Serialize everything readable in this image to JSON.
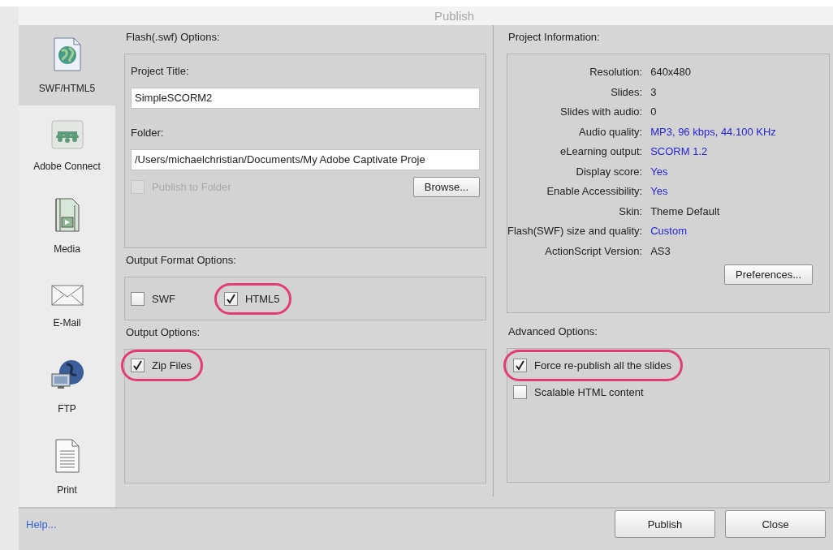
{
  "window": {
    "title": "Publish"
  },
  "sidebar": {
    "items": [
      {
        "label": "SWF/HTML5",
        "kind": "globe",
        "selected": true
      },
      {
        "label": "Adobe Connect",
        "kind": "connect",
        "selected": false
      },
      {
        "label": "Media",
        "kind": "media",
        "selected": false
      },
      {
        "label": "E-Mail",
        "kind": "mail",
        "selected": false
      },
      {
        "label": "FTP",
        "kind": "ftp",
        "selected": false
      },
      {
        "label": "Print",
        "kind": "print",
        "selected": false
      }
    ]
  },
  "flash_options": {
    "heading": "Flash(.swf) Options:",
    "project_title_label": "Project Title:",
    "project_title": "SimpleSCORM2",
    "folder_label": "Folder:",
    "folder": "/Users/michaelchristian/Documents/My Adobe Captivate Proje",
    "publish_to_folder": {
      "label": "Publish to Folder",
      "checked": false,
      "disabled": true
    },
    "browse_button": "Browse..."
  },
  "output_format": {
    "heading": "Output Format Options:",
    "options": [
      {
        "label": "SWF",
        "checked": false,
        "highlighted": false
      },
      {
        "label": "HTML5",
        "checked": true,
        "highlighted": true
      }
    ]
  },
  "output_options": {
    "heading": "Output Options:",
    "options": [
      {
        "label": "Zip Files",
        "checked": true,
        "highlighted": true
      }
    ]
  },
  "project_information": {
    "heading": "Project Information:",
    "rows": [
      {
        "label": "Resolution:",
        "value": "640x480",
        "kind": "plain"
      },
      {
        "label": "Slides:",
        "value": "3",
        "kind": "plain"
      },
      {
        "label": "Slides with audio:",
        "value": "0",
        "kind": "plain"
      },
      {
        "label": "Audio quality:",
        "value": "MP3, 96 kbps, 44.100 KHz",
        "kind": "link"
      },
      {
        "label": "eLearning output:",
        "value": "SCORM 1.2",
        "kind": "link"
      },
      {
        "label": "Display score:",
        "value": "Yes",
        "kind": "link"
      },
      {
        "label": "Enable Accessibility:",
        "value": "Yes",
        "kind": "link"
      },
      {
        "label": "Skin:",
        "value": "Theme Default",
        "kind": "plain"
      },
      {
        "label": "Flash(SWF) size and quality:",
        "value": "Custom",
        "kind": "link"
      },
      {
        "label": "ActionScript Version:",
        "value": "AS3",
        "kind": "plain"
      }
    ],
    "preferences_button": "Preferences..."
  },
  "advanced_options": {
    "heading": "Advanced Options:",
    "options": [
      {
        "label": "Force re-publish all the slides",
        "checked": true,
        "highlighted": true
      },
      {
        "label": "Scalable HTML content",
        "checked": false,
        "highlighted": false
      }
    ]
  },
  "footer": {
    "help_link": "Help...",
    "buttons": [
      "Publish",
      "Close"
    ]
  }
}
